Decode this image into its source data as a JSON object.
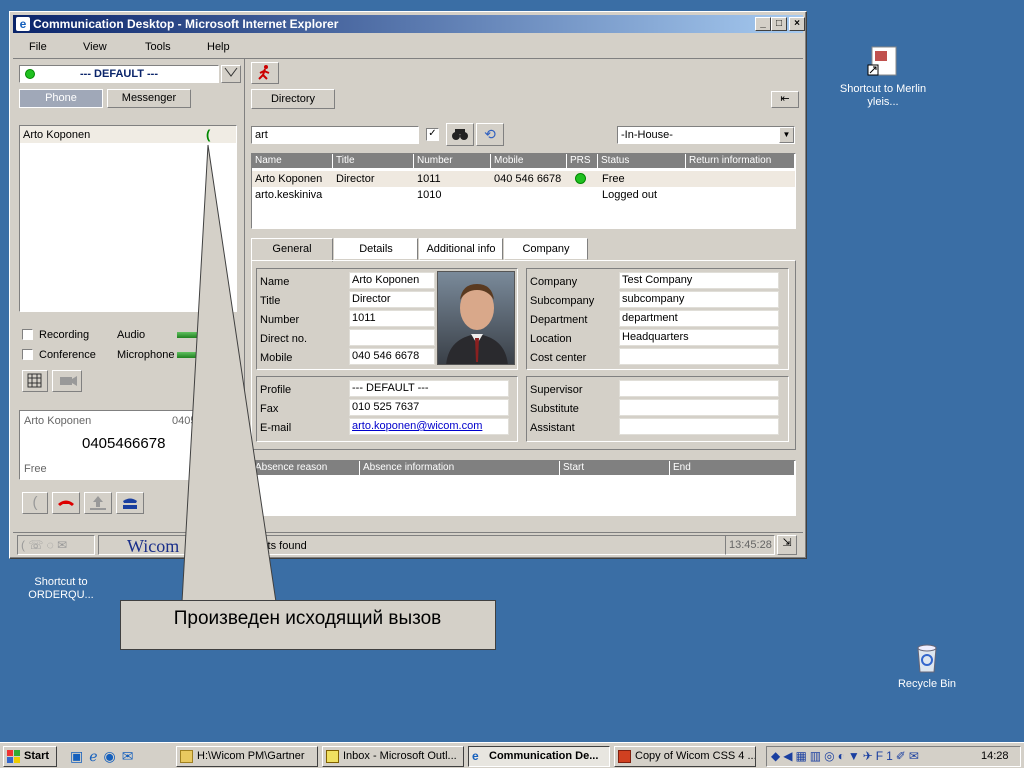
{
  "desktop": {
    "icons": [
      {
        "label": "Shortcut to Merlin yleis..."
      },
      {
        "label": "Shortcut to ORDERQU..."
      },
      {
        "label": "Recycle Bin"
      }
    ]
  },
  "window": {
    "title": "Communication Desktop - Microsoft Internet Explorer",
    "menu": [
      "File",
      "View",
      "Tools",
      "Help"
    ],
    "profile_value": "--- DEFAULT ---",
    "left_tabs": [
      "Phone",
      "Messenger"
    ],
    "right_tab": "Directory",
    "calls": [
      {
        "name": "Arto Koponen"
      }
    ],
    "recording_label": "Recording",
    "conference_label": "Conference",
    "audio_label": "Audio",
    "microphone_label": "Microphone",
    "call_panel": {
      "name": "Arto Koponen",
      "number_short": "0405",
      "dialed": "0405466678",
      "state": "Free"
    },
    "logo_text": "Wicom",
    "status_text": "ults found",
    "status_time": "13:45:28",
    "search": {
      "value": "art",
      "scope": "-In-House-"
    },
    "results": {
      "columns": [
        "Name",
        "Title",
        "Number",
        "Mobile",
        "PRS",
        "Status",
        "Return information"
      ],
      "rows": [
        {
          "name": "Arto Koponen",
          "title": "Director",
          "number": "1011",
          "mobile": "040 546 6678",
          "prs": "green",
          "status": "Free",
          "return": ""
        },
        {
          "name": "arto.keskiniva",
          "title": "",
          "number": "1010",
          "mobile": "",
          "prs": "",
          "status": "Logged out",
          "return": ""
        }
      ]
    },
    "detail_tabs": [
      "General",
      "Details",
      "Additional info",
      "Company"
    ],
    "details": {
      "name_label": "Name",
      "name": "Arto Koponen",
      "title_label": "Title",
      "title": "Director",
      "number_label": "Number",
      "number": "1011",
      "direct_label": "Direct no.",
      "direct": "",
      "mobile_label": "Mobile",
      "mobile": "040 546 6678",
      "company_label": "Company",
      "company": "Test Company",
      "subcompany_label": "Subcompany",
      "subcompany": "subcompany",
      "department_label": "Department",
      "department": "department",
      "location_label": "Location",
      "location": "Headquarters",
      "cost_label": "Cost center",
      "cost": "",
      "profile_label": "Profile",
      "profile": "--- DEFAULT ---",
      "fax_label": "Fax",
      "fax": "010 525 7637",
      "email_label": "E-mail",
      "email": "arto.koponen@wicom.com",
      "supervisor_label": "Supervisor",
      "supervisor": "",
      "substitute_label": "Substitute",
      "substitute": "",
      "assistant_label": "Assistant",
      "assistant": ""
    },
    "absence_columns": [
      "Absence reason",
      "Absence information",
      "Start",
      "End"
    ]
  },
  "callout": {
    "text": "Произведен исходящий вызов"
  },
  "taskbar": {
    "start_label": "Start",
    "tasks": [
      {
        "label": "H:\\Wicom PM\\Gartner"
      },
      {
        "label": "Inbox - Microsoft Outl..."
      },
      {
        "label": "Communication De..."
      },
      {
        "label": "Copy of Wicom CSS 4 ..."
      }
    ],
    "clock": "14:28"
  },
  "colors": {
    "desktop": "#3a6ea5",
    "title_active": "#0a246a",
    "presence_free": "#20c020"
  }
}
